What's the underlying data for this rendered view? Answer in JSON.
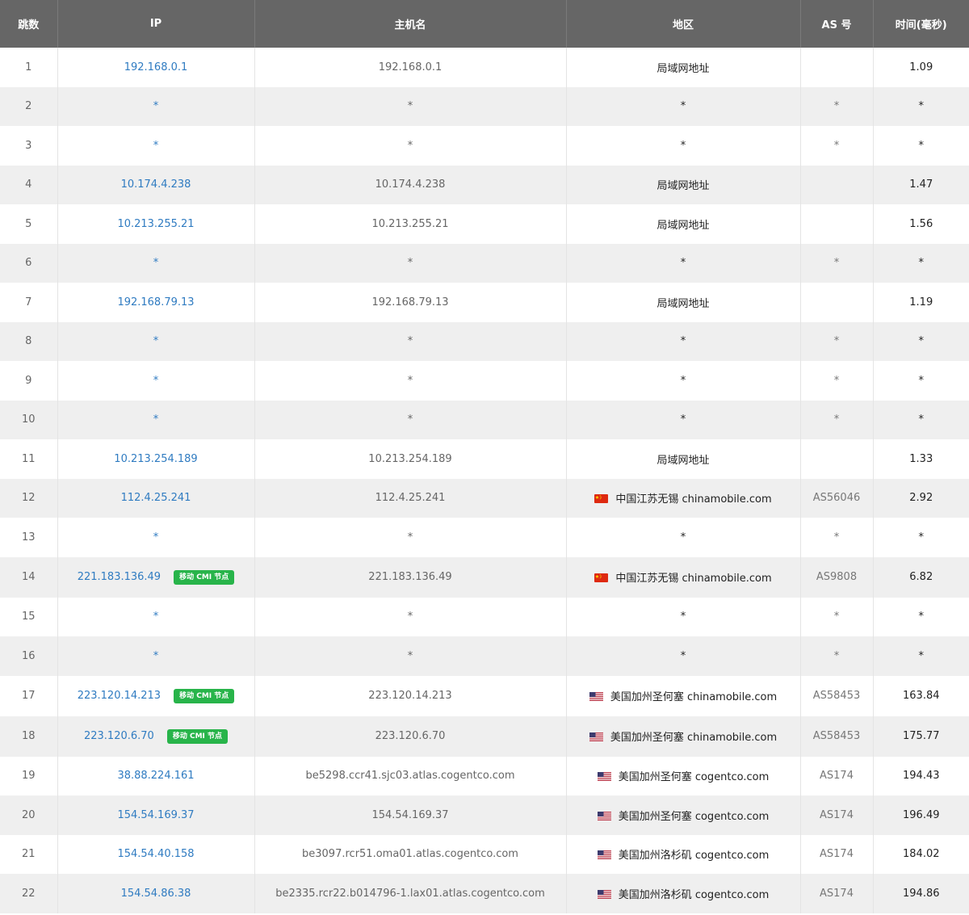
{
  "headers": {
    "hop": "跳数",
    "ip": "IP",
    "hostname": "主机名",
    "region": "地区",
    "as": "AS 号",
    "time": "时间(毫秒)"
  },
  "badge_label": "移动 CMI 节点",
  "colors": {
    "header_bg": "#666666",
    "ip_link": "#2f7bc1",
    "badge_green": "#28b44a",
    "row_alt": "#efefef"
  },
  "rows": [
    {
      "hop": "1",
      "ip": "192.168.0.1",
      "hostname": "192.168.0.1",
      "flag": "",
      "region": "局域网地址",
      "as": "",
      "time": "1.09",
      "badge": false
    },
    {
      "hop": "2",
      "ip": "*",
      "hostname": "*",
      "flag": "",
      "region": "*",
      "as": "*",
      "time": "*",
      "badge": false
    },
    {
      "hop": "3",
      "ip": "*",
      "hostname": "*",
      "flag": "",
      "region": "*",
      "as": "*",
      "time": "*",
      "badge": false
    },
    {
      "hop": "4",
      "ip": "10.174.4.238",
      "hostname": "10.174.4.238",
      "flag": "",
      "region": "局域网地址",
      "as": "",
      "time": "1.47",
      "badge": false
    },
    {
      "hop": "5",
      "ip": "10.213.255.21",
      "hostname": "10.213.255.21",
      "flag": "",
      "region": "局域网地址",
      "as": "",
      "time": "1.56",
      "badge": false
    },
    {
      "hop": "6",
      "ip": "*",
      "hostname": "*",
      "flag": "",
      "region": "*",
      "as": "*",
      "time": "*",
      "badge": false
    },
    {
      "hop": "7",
      "ip": "192.168.79.13",
      "hostname": "192.168.79.13",
      "flag": "",
      "region": "局域网地址",
      "as": "",
      "time": "1.19",
      "badge": false
    },
    {
      "hop": "8",
      "ip": "*",
      "hostname": "*",
      "flag": "",
      "region": "*",
      "as": "*",
      "time": "*",
      "badge": false
    },
    {
      "hop": "9",
      "ip": "*",
      "hostname": "*",
      "flag": "",
      "region": "*",
      "as": "*",
      "time": "*",
      "badge": false
    },
    {
      "hop": "10",
      "ip": "*",
      "hostname": "*",
      "flag": "",
      "region": "*",
      "as": "*",
      "time": "*",
      "badge": false
    },
    {
      "hop": "11",
      "ip": "10.213.254.189",
      "hostname": "10.213.254.189",
      "flag": "",
      "region": "局域网地址",
      "as": "",
      "time": "1.33",
      "badge": false
    },
    {
      "hop": "12",
      "ip": "112.4.25.241",
      "hostname": "112.4.25.241",
      "flag": "cn-flag",
      "region": "中国江苏无锡 chinamobile.com",
      "as": "AS56046",
      "time": "2.92",
      "badge": false
    },
    {
      "hop": "13",
      "ip": "*",
      "hostname": "*",
      "flag": "",
      "region": "*",
      "as": "*",
      "time": "*",
      "badge": false
    },
    {
      "hop": "14",
      "ip": "221.183.136.49",
      "hostname": "221.183.136.49",
      "flag": "cn-flag",
      "region": "中国江苏无锡 chinamobile.com",
      "as": "AS9808",
      "time": "6.82",
      "badge": true
    },
    {
      "hop": "15",
      "ip": "*",
      "hostname": "*",
      "flag": "",
      "region": "*",
      "as": "*",
      "time": "*",
      "badge": false
    },
    {
      "hop": "16",
      "ip": "*",
      "hostname": "*",
      "flag": "",
      "region": "*",
      "as": "*",
      "time": "*",
      "badge": false
    },
    {
      "hop": "17",
      "ip": "223.120.14.213",
      "hostname": "223.120.14.213",
      "flag": "us-flag",
      "region": "美国加州圣何塞 chinamobile.com",
      "as": "AS58453",
      "time": "163.84",
      "badge": true
    },
    {
      "hop": "18",
      "ip": "223.120.6.70",
      "hostname": "223.120.6.70",
      "flag": "us-flag",
      "region": "美国加州圣何塞 chinamobile.com",
      "as": "AS58453",
      "time": "175.77",
      "badge": true
    },
    {
      "hop": "19",
      "ip": "38.88.224.161",
      "hostname": "be5298.ccr41.sjc03.atlas.cogentco.com",
      "flag": "us-flag",
      "region": "美国加州圣何塞 cogentco.com",
      "as": "AS174",
      "time": "194.43",
      "badge": false
    },
    {
      "hop": "20",
      "ip": "154.54.169.37",
      "hostname": "154.54.169.37",
      "flag": "us-flag",
      "region": "美国加州圣何塞 cogentco.com",
      "as": "AS174",
      "time": "196.49",
      "badge": false
    },
    {
      "hop": "21",
      "ip": "154.54.40.158",
      "hostname": "be3097.rcr51.oma01.atlas.cogentco.com",
      "flag": "us-flag",
      "region": "美国加州洛杉矶 cogentco.com",
      "as": "AS174",
      "time": "184.02",
      "badge": false
    },
    {
      "hop": "22",
      "ip": "154.54.86.38",
      "hostname": "be2335.rcr22.b014796-1.lax01.atlas.cogentco.com",
      "flag": "us-flag",
      "region": "美国加州洛杉矶 cogentco.com",
      "as": "AS174",
      "time": "194.86",
      "badge": false
    }
  ]
}
